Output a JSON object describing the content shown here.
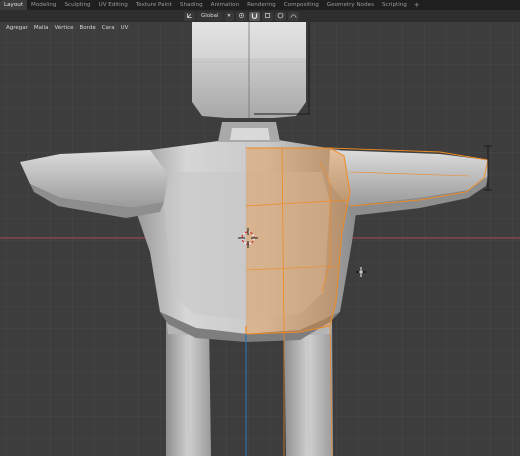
{
  "workspace_tabs": [
    "Layout",
    "Modeling",
    "Sculpting",
    "UV Editing",
    "Texture Paint",
    "Shading",
    "Animation",
    "Rendering",
    "Compositing",
    "Geometry Nodes",
    "Scripting"
  ],
  "active_tab": "Layout",
  "add_tab_label": "+",
  "toolbar": {
    "transform_orientation": "Global",
    "orientation_icon": "axes-icon",
    "pivot_icon": "pivot-icon",
    "snap_icon": "magnet-icon",
    "proportional_icon": "proportional-edit-icon"
  },
  "menu": [
    "Agregar",
    "Malla",
    "Vértice",
    "Borde",
    "Cara",
    "UV"
  ],
  "colors": {
    "viewport_bg": "#3d3d3d",
    "grid_line": "#4a4a4a",
    "x_axis": "#b84b4b",
    "z_axis": "#2f6fb4",
    "selection": "#f08a24",
    "mesh_light": "#d9d9d9",
    "mesh_dark": "#8c8c8c"
  },
  "viewport": {
    "content": "low-poly-character-mesh",
    "selection_state": "right-half-faces-selected",
    "cursor_icon": "3d-cursor-icon",
    "pointer_icon": "crosshair-cursor-icon"
  }
}
